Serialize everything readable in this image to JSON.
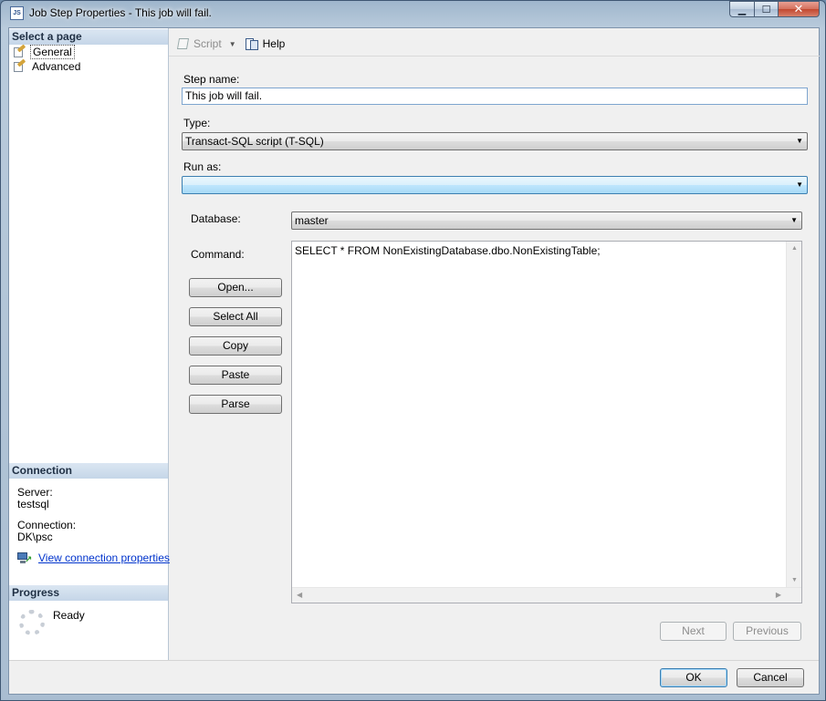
{
  "window": {
    "title": "Job Step Properties - This job will fail.",
    "app_icon_text": "JS",
    "minimize_glyph": "▁",
    "maximize_glyph": "☐",
    "close_glyph": "✕"
  },
  "left_pane": {
    "select_page_header": "Select a page",
    "pages": [
      {
        "label": "General",
        "selected": true
      },
      {
        "label": "Advanced",
        "selected": false
      }
    ],
    "connection_header": "Connection",
    "server_label": "Server:",
    "server_value": "testsql",
    "connection_label": "Connection:",
    "connection_value": "DK\\psc",
    "view_connection_link": "View connection properties",
    "progress_header": "Progress",
    "progress_status": "Ready"
  },
  "toolbar": {
    "script_label": "Script",
    "help_label": "Help"
  },
  "form": {
    "step_name_label": "Step name:",
    "step_name_value": "This job will fail.",
    "type_label": "Type:",
    "type_value": "Transact-SQL script (T-SQL)",
    "run_as_label": "Run as:",
    "run_as_value": "",
    "database_label": "Database:",
    "database_value": "master",
    "command_label": "Command:",
    "command_value": "SELECT * FROM NonExistingDatabase.dbo.NonExistingTable;"
  },
  "command_buttons": {
    "open": "Open...",
    "select_all": "Select All",
    "copy": "Copy",
    "paste": "Paste",
    "parse": "Parse"
  },
  "nav_buttons": {
    "next": "Next",
    "previous": "Previous"
  },
  "dialog_buttons": {
    "ok": "OK",
    "cancel": "Cancel"
  },
  "icons": {
    "dropdown_arrow": "▼",
    "scroll_up": "▲",
    "scroll_down": "▼",
    "scroll_left": "◀",
    "scroll_right": "▶"
  }
}
